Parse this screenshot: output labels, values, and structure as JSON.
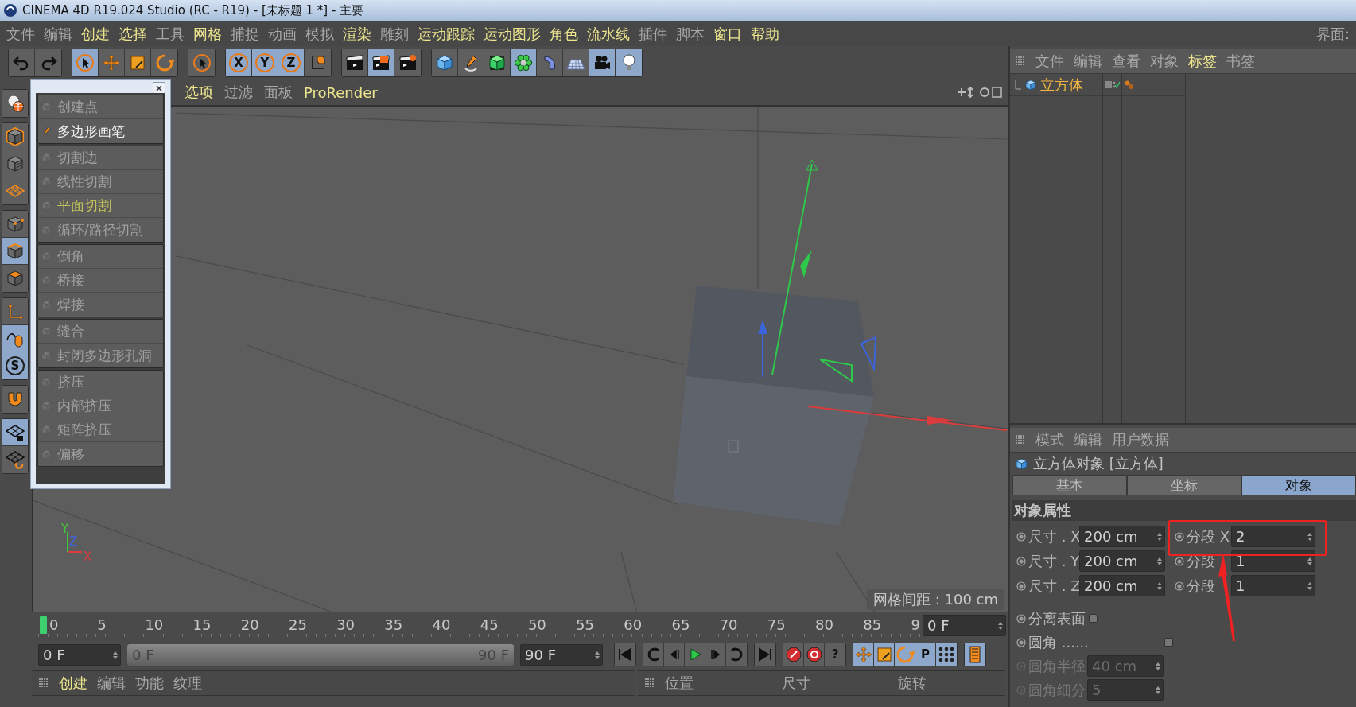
{
  "window": {
    "title": "CINEMA 4D R19.024 Studio (RC - R19) - [未标题 1 *] - 主要"
  },
  "menu": [
    {
      "label": "文件",
      "highlighted": false
    },
    {
      "label": "编辑",
      "highlighted": false
    },
    {
      "label": "创建",
      "highlighted": true
    },
    {
      "label": "选择",
      "highlighted": true
    },
    {
      "label": "工具",
      "highlighted": false
    },
    {
      "label": "网格",
      "highlighted": true
    },
    {
      "label": "捕捉",
      "highlighted": false
    },
    {
      "label": "动画",
      "highlighted": false
    },
    {
      "label": "模拟",
      "highlighted": false
    },
    {
      "label": "渲染",
      "highlighted": true
    },
    {
      "label": "雕刻",
      "highlighted": false
    },
    {
      "label": "运动跟踪",
      "highlighted": true
    },
    {
      "label": "运动图形",
      "highlighted": true
    },
    {
      "label": "角色",
      "highlighted": true
    },
    {
      "label": "流水线",
      "highlighted": true
    },
    {
      "label": "插件",
      "highlighted": false
    },
    {
      "label": "脚本",
      "highlighted": false
    },
    {
      "label": "窗口",
      "highlighted": true
    },
    {
      "label": "帮助",
      "highlighted": true
    }
  ],
  "layout_label": "界面:",
  "toolbar": [
    {
      "tools": [
        {
          "kind": "undo",
          "selected": false
        },
        {
          "kind": "redo",
          "selected": false
        }
      ]
    },
    {
      "tools": [
        {
          "kind": "cursor",
          "selected": true
        },
        {
          "kind": "move",
          "selected": false
        },
        {
          "kind": "scale",
          "selected": false
        },
        {
          "kind": "rotate",
          "selected": false
        }
      ]
    },
    {
      "tools": [
        {
          "kind": "cursor",
          "selected": false
        }
      ]
    },
    {
      "tools": [
        {
          "kind": "axis-lock",
          "label": "X",
          "selected": true
        },
        {
          "kind": "axis-lock",
          "label": "Y",
          "selected": true
        },
        {
          "kind": "axis-lock",
          "label": "Z",
          "selected": true
        },
        {
          "kind": "coord",
          "selected": false
        }
      ]
    },
    {
      "tools": [
        {
          "kind": "render-view",
          "selected": false
        },
        {
          "kind": "render-picture",
          "selected": true
        },
        {
          "kind": "render-settings",
          "selected": false
        }
      ]
    },
    {
      "tools": [
        {
          "kind": "cube",
          "selected": false
        },
        {
          "kind": "pen",
          "selected": false
        },
        {
          "kind": "subdiv",
          "selected": false
        },
        {
          "kind": "cloner",
          "selected": true
        },
        {
          "kind": "deformer",
          "selected": false
        },
        {
          "kind": "floor",
          "selected": false
        },
        {
          "kind": "camera",
          "selected": true
        },
        {
          "kind": "light",
          "selected": true
        }
      ]
    }
  ],
  "mode_bar": [
    {
      "tools": [
        {
          "kind": "globe",
          "selected": false
        }
      ]
    },
    {
      "tools": [
        {
          "kind": "model",
          "selected": false
        },
        {
          "kind": "texture",
          "selected": false
        },
        {
          "kind": "workplane",
          "selected": false
        }
      ]
    },
    {
      "tools": [
        {
          "kind": "points",
          "selected": false
        },
        {
          "kind": "edges",
          "selected": true
        },
        {
          "kind": "polygons",
          "selected": false
        }
      ]
    },
    {
      "tools": [
        {
          "kind": "axis",
          "selected": false
        },
        {
          "kind": "mouse",
          "selected": true
        },
        {
          "kind": "solo",
          "label": "S",
          "selected": true
        }
      ]
    },
    {
      "tools": [
        {
          "kind": "magnet",
          "selected": false
        }
      ]
    },
    {
      "tools": [
        {
          "kind": "grid-lock",
          "selected": true
        },
        {
          "kind": "grid-sync",
          "selected": false
        }
      ]
    }
  ],
  "tool_palette": {
    "groups": [
      {
        "items": [
          {
            "label": "创建点",
            "disabled": true,
            "highlighted": false
          },
          {
            "label": "多边形画笔",
            "disabled": false,
            "highlighted": false
          }
        ]
      },
      {
        "items": [
          {
            "label": "切割边",
            "disabled": true,
            "highlighted": false
          },
          {
            "label": "线性切割",
            "disabled": true,
            "highlighted": false
          },
          {
            "label": "平面切割",
            "disabled": true,
            "highlighted": true
          },
          {
            "label": "循环/路径切割",
            "disabled": true,
            "highlighted": false
          }
        ]
      },
      {
        "items": [
          {
            "label": "倒角",
            "disabled": true,
            "highlighted": false
          },
          {
            "label": "桥接",
            "disabled": true,
            "highlighted": false
          },
          {
            "label": "焊接",
            "disabled": true,
            "highlighted": false
          }
        ]
      },
      {
        "items": [
          {
            "label": "缝合",
            "disabled": true,
            "highlighted": false
          },
          {
            "label": "封闭多边形孔洞",
            "disabled": true,
            "highlighted": false
          }
        ]
      },
      {
        "items": [
          {
            "label": "挤压",
            "disabled": true,
            "highlighted": false
          },
          {
            "label": "内部挤压",
            "disabled": true,
            "highlighted": false
          },
          {
            "label": "矩阵挤压",
            "disabled": true,
            "highlighted": false
          },
          {
            "label": "偏移",
            "disabled": true,
            "highlighted": false
          }
        ]
      }
    ]
  },
  "viewport": {
    "menu": [
      {
        "label": "选项",
        "highlighted": true
      },
      {
        "label": "过滤",
        "highlighted": false
      },
      {
        "label": "面板",
        "highlighted": false
      },
      {
        "label": "ProRender",
        "highlighted": true
      }
    ],
    "axes": [
      {
        "label": "Y",
        "color": "#3cc83c"
      },
      {
        "label": "Z",
        "color": "#3c64dc"
      },
      {
        "label": "X",
        "color": "#dc3c3c"
      }
    ],
    "grid_label": "网格间距 : 100 cm"
  },
  "timeline": {
    "ticks": [
      "0",
      "5",
      "10",
      "15",
      "20",
      "25",
      "30",
      "35",
      "40",
      "45",
      "50",
      "55",
      "60",
      "65",
      "70",
      "75",
      "80",
      "85",
      "9"
    ],
    "frame": "0 F"
  },
  "transport": {
    "start": "0 F",
    "range": {
      "start": "0 F",
      "end": "90 F",
      "level": 1
    },
    "end": "90 F",
    "groups": [
      {
        "buttons": [
          {
            "kind": "skip-start",
            "selected": false
          }
        ]
      },
      {
        "buttons": [
          {
            "kind": "loop-back",
            "selected": false
          },
          {
            "kind": "step-back",
            "selected": false
          },
          {
            "kind": "play",
            "selected": false
          },
          {
            "kind": "step-forward",
            "selected": false
          },
          {
            "kind": "loop-forward",
            "selected": false
          }
        ]
      },
      {
        "buttons": [
          {
            "kind": "skip-end",
            "selected": false
          }
        ]
      },
      {
        "buttons": [
          {
            "kind": "record",
            "selected": false
          },
          {
            "kind": "autokey",
            "selected": false
          },
          {
            "kind": "help",
            "label": "?",
            "selected": false
          }
        ]
      },
      {
        "buttons": [
          {
            "kind": "move",
            "selected": true
          },
          {
            "kind": "scale",
            "selected": true
          },
          {
            "kind": "rotate",
            "selected": true
          },
          {
            "kind": "param",
            "label": "P",
            "selected": true
          },
          {
            "kind": "dots",
            "selected": true
          }
        ]
      },
      {
        "buttons": [
          {
            "kind": "film",
            "selected": true
          }
        ]
      }
    ]
  },
  "material_manager": {
    "menu": [
      {
        "label": "创建",
        "highlighted": true
      },
      {
        "label": "编辑",
        "highlighted": false
      },
      {
        "label": "功能",
        "highlighted": false
      },
      {
        "label": "纹理",
        "highlighted": false
      }
    ]
  },
  "coordinate_manager": {
    "columns": [
      "位置",
      "尺寸",
      "旋转"
    ]
  },
  "object_manager": {
    "menu": [
      {
        "label": "文件",
        "highlighted": false
      },
      {
        "label": "编辑",
        "highlighted": false
      },
      {
        "label": "查看",
        "highlighted": false
      },
      {
        "label": "对象",
        "highlighted": false
      },
      {
        "label": "标签",
        "highlighted": true
      },
      {
        "label": "书签",
        "highlighted": false
      }
    ],
    "objects": [
      {
        "name": "立方体",
        "selected": true
      }
    ]
  },
  "attribute_manager": {
    "menu": [
      "模式",
      "编辑",
      "用户数据"
    ],
    "title": "立方体对象 [立方体]",
    "tabs": [
      {
        "label": "基本",
        "selected": false
      },
      {
        "label": "坐标",
        "selected": false
      },
      {
        "label": "对象",
        "selected": true
      }
    ],
    "section": "对象属性",
    "dimension_rows": [
      {
        "label": "尺寸 . X",
        "value": "200 cm",
        "segment_label": "分段 X",
        "segment_value": "2"
      },
      {
        "label": "尺寸 . Y",
        "value": "200 cm",
        "segment_label": "分段",
        "segment_value": "1"
      },
      {
        "label": "尺寸 . Z",
        "value": "200 cm",
        "segment_label": "分段",
        "segment_value": "1"
      }
    ],
    "options": [
      {
        "kind": "checkbox",
        "label": "分离表面",
        "checked": false,
        "disabled": false
      },
      {
        "kind": "checkbox",
        "label": "圆角 ......",
        "checked": false,
        "disabled": false
      },
      {
        "kind": "number",
        "label": "圆角半径",
        "value": "40 cm",
        "disabled": true
      },
      {
        "kind": "number",
        "label": "圆角细分",
        "value": "5",
        "disabled": true
      }
    ]
  }
}
